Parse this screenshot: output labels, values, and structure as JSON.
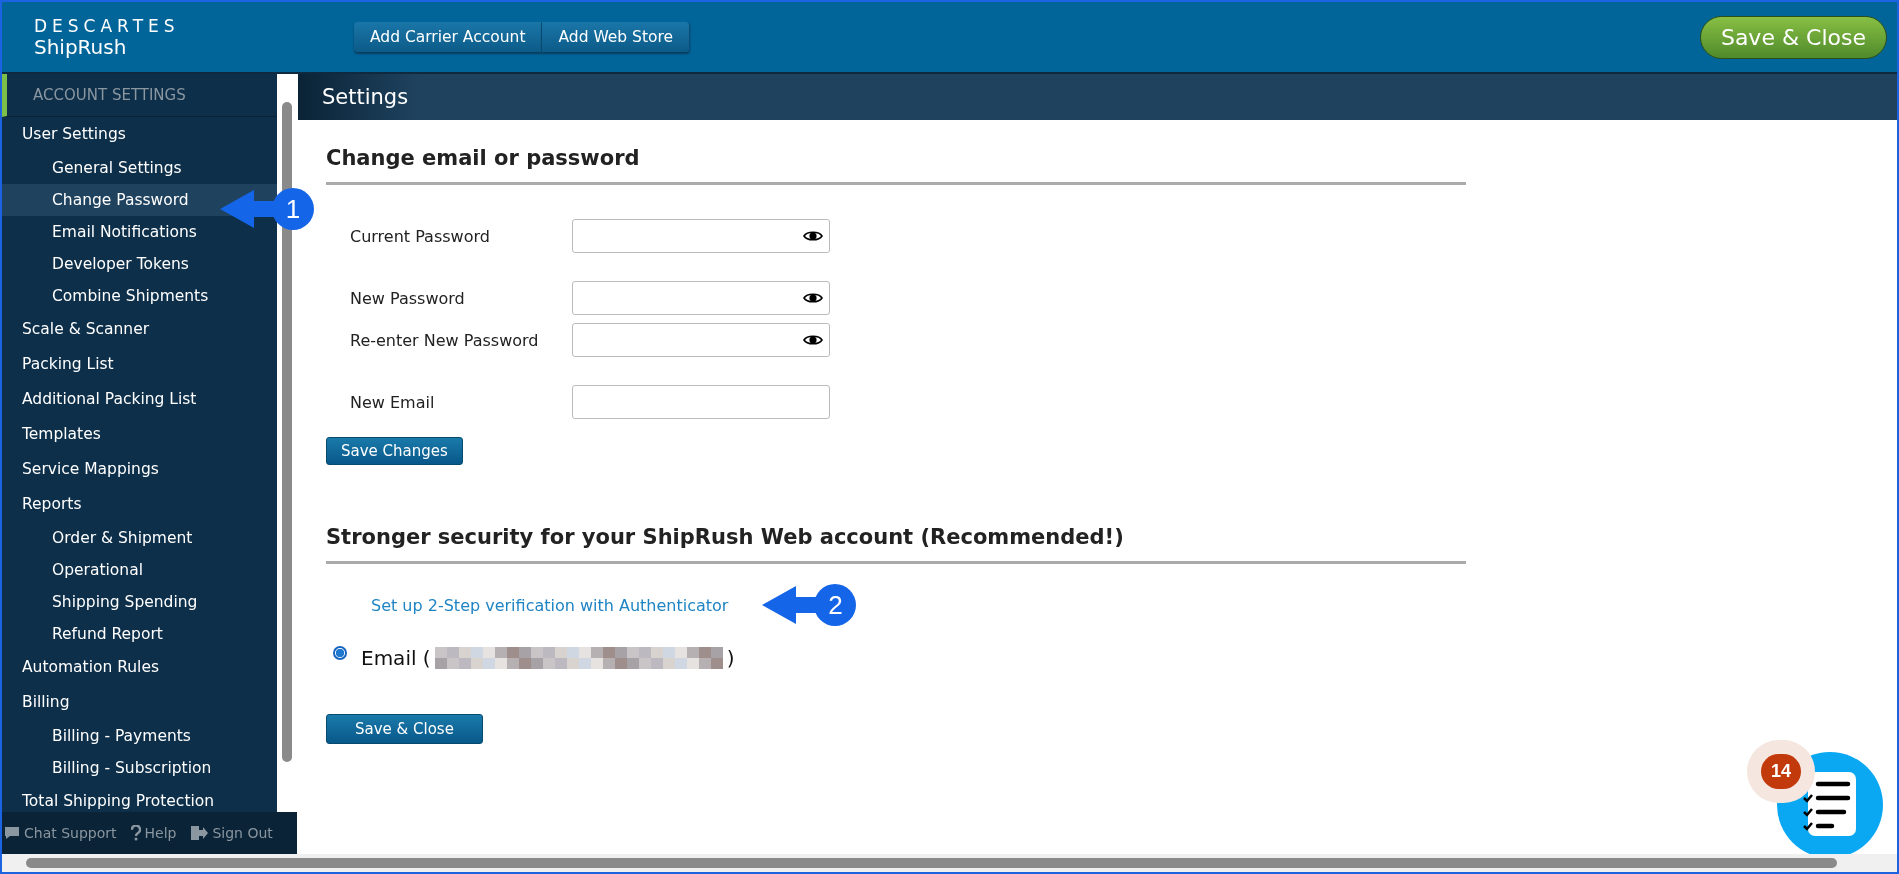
{
  "header": {
    "logo_top": "DESCARTES",
    "logo_bottom": "ShipRush",
    "actions": [
      "Add Carrier Account",
      "Add Web Store"
    ],
    "save_close": "Save & Close"
  },
  "sidebar": {
    "heading": "ACCOUNT SETTINGS",
    "items": [
      {
        "label": "User Settings",
        "selected": false,
        "children": [
          {
            "label": "General Settings",
            "selected": false
          },
          {
            "label": "Change Password",
            "selected": true
          },
          {
            "label": "Email Notifications",
            "selected": false
          },
          {
            "label": "Developer Tokens",
            "selected": false
          },
          {
            "label": "Combine Shipments",
            "selected": false
          }
        ]
      },
      {
        "label": "Scale & Scanner",
        "selected": false
      },
      {
        "label": "Packing List",
        "selected": false
      },
      {
        "label": "Additional Packing List",
        "selected": false
      },
      {
        "label": "Templates",
        "selected": false
      },
      {
        "label": "Service Mappings",
        "selected": false
      },
      {
        "label": "Reports",
        "selected": false,
        "children": [
          {
            "label": "Order & Shipment",
            "selected": false
          },
          {
            "label": "Operational",
            "selected": false
          },
          {
            "label": "Shipping Spending",
            "selected": false
          },
          {
            "label": "Refund Report",
            "selected": false
          }
        ]
      },
      {
        "label": "Automation Rules",
        "selected": false
      },
      {
        "label": "Billing",
        "selected": false,
        "children": [
          {
            "label": "Billing - Payments",
            "selected": false
          },
          {
            "label": "Billing - Subscription",
            "selected": false
          }
        ]
      },
      {
        "label": "Total Shipping Protection",
        "selected": false
      }
    ],
    "footer": [
      {
        "kind": "chat",
        "label": "Chat Support"
      },
      {
        "kind": "help",
        "label": "Help"
      },
      {
        "kind": "signout",
        "label": "Sign Out"
      }
    ]
  },
  "page_title": "Settings",
  "password_section": {
    "title": "Change email or password",
    "field_groups": [
      [
        {
          "label": "Current Password",
          "kind": "password"
        }
      ],
      [
        {
          "label": "New Password",
          "kind": "password"
        },
        {
          "label": "Re-enter New Password",
          "kind": "password"
        }
      ],
      [
        {
          "label": "New Email",
          "kind": "text"
        }
      ]
    ],
    "button": "Save Changes"
  },
  "security_section": {
    "title": "Stronger security for your ShipRush Web account (Recommended!)",
    "link": "Set up 2-Step verification with Authenticator",
    "radio": {
      "label_start": "Email (",
      "label_end": ")",
      "checked": true
    },
    "button": "Save & Close"
  },
  "callouts": [
    {
      "number": "1"
    },
    {
      "number": "2"
    }
  ],
  "checklist_badge": "14"
}
